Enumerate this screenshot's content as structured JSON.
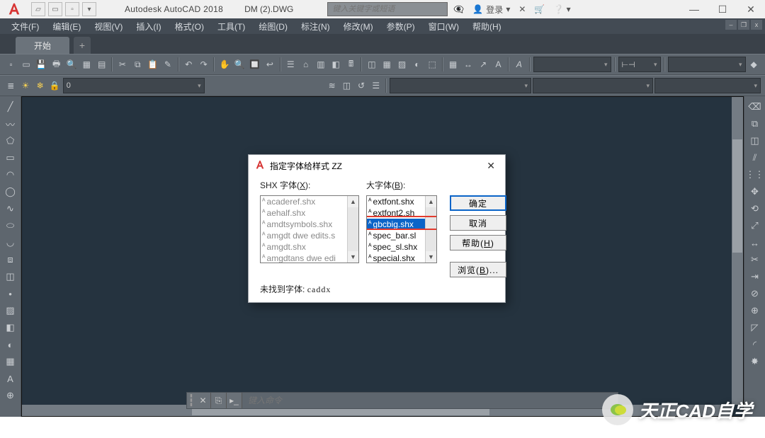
{
  "title": {
    "app": "Autodesk AutoCAD 2018",
    "doc": "DM (2).DWG"
  },
  "search_placeholder": "键入关键字或短语",
  "login": "登录",
  "menus": [
    "文件(F)",
    "编辑(E)",
    "视图(V)",
    "插入(I)",
    "格式(O)",
    "工具(T)",
    "绘图(D)",
    "标注(N)",
    "修改(M)",
    "参数(P)",
    "窗口(W)",
    "帮助(H)"
  ],
  "tab": "开始",
  "layer_combo": "0",
  "cmd_placeholder": "键入命令",
  "dialog": {
    "title": "指定字体给样式 ZZ",
    "shx_label": "SHX 字体(X):",
    "big_label": "大字体(B):",
    "shx_items": [
      "acaderef.shx",
      "aehalf.shx",
      "amdtsymbols.shx",
      "amgdt dwe edits.s",
      "amgdt.shx",
      "amgdtans dwe edi"
    ],
    "big_items": [
      "extfont.shx",
      "extfont2.sh",
      "gbcbig.shx",
      "spec_bar.sl",
      "spec_sl.shx",
      "special.shx"
    ],
    "selected_big": "gbcbig.shx",
    "buttons": {
      "ok": "确定",
      "cancel": "取消",
      "help": "帮助(H)",
      "browse": "浏览(B)..."
    },
    "footer_label": "未找到字体:",
    "footer_value": "caddx"
  },
  "watermark": "天正CAD自学"
}
